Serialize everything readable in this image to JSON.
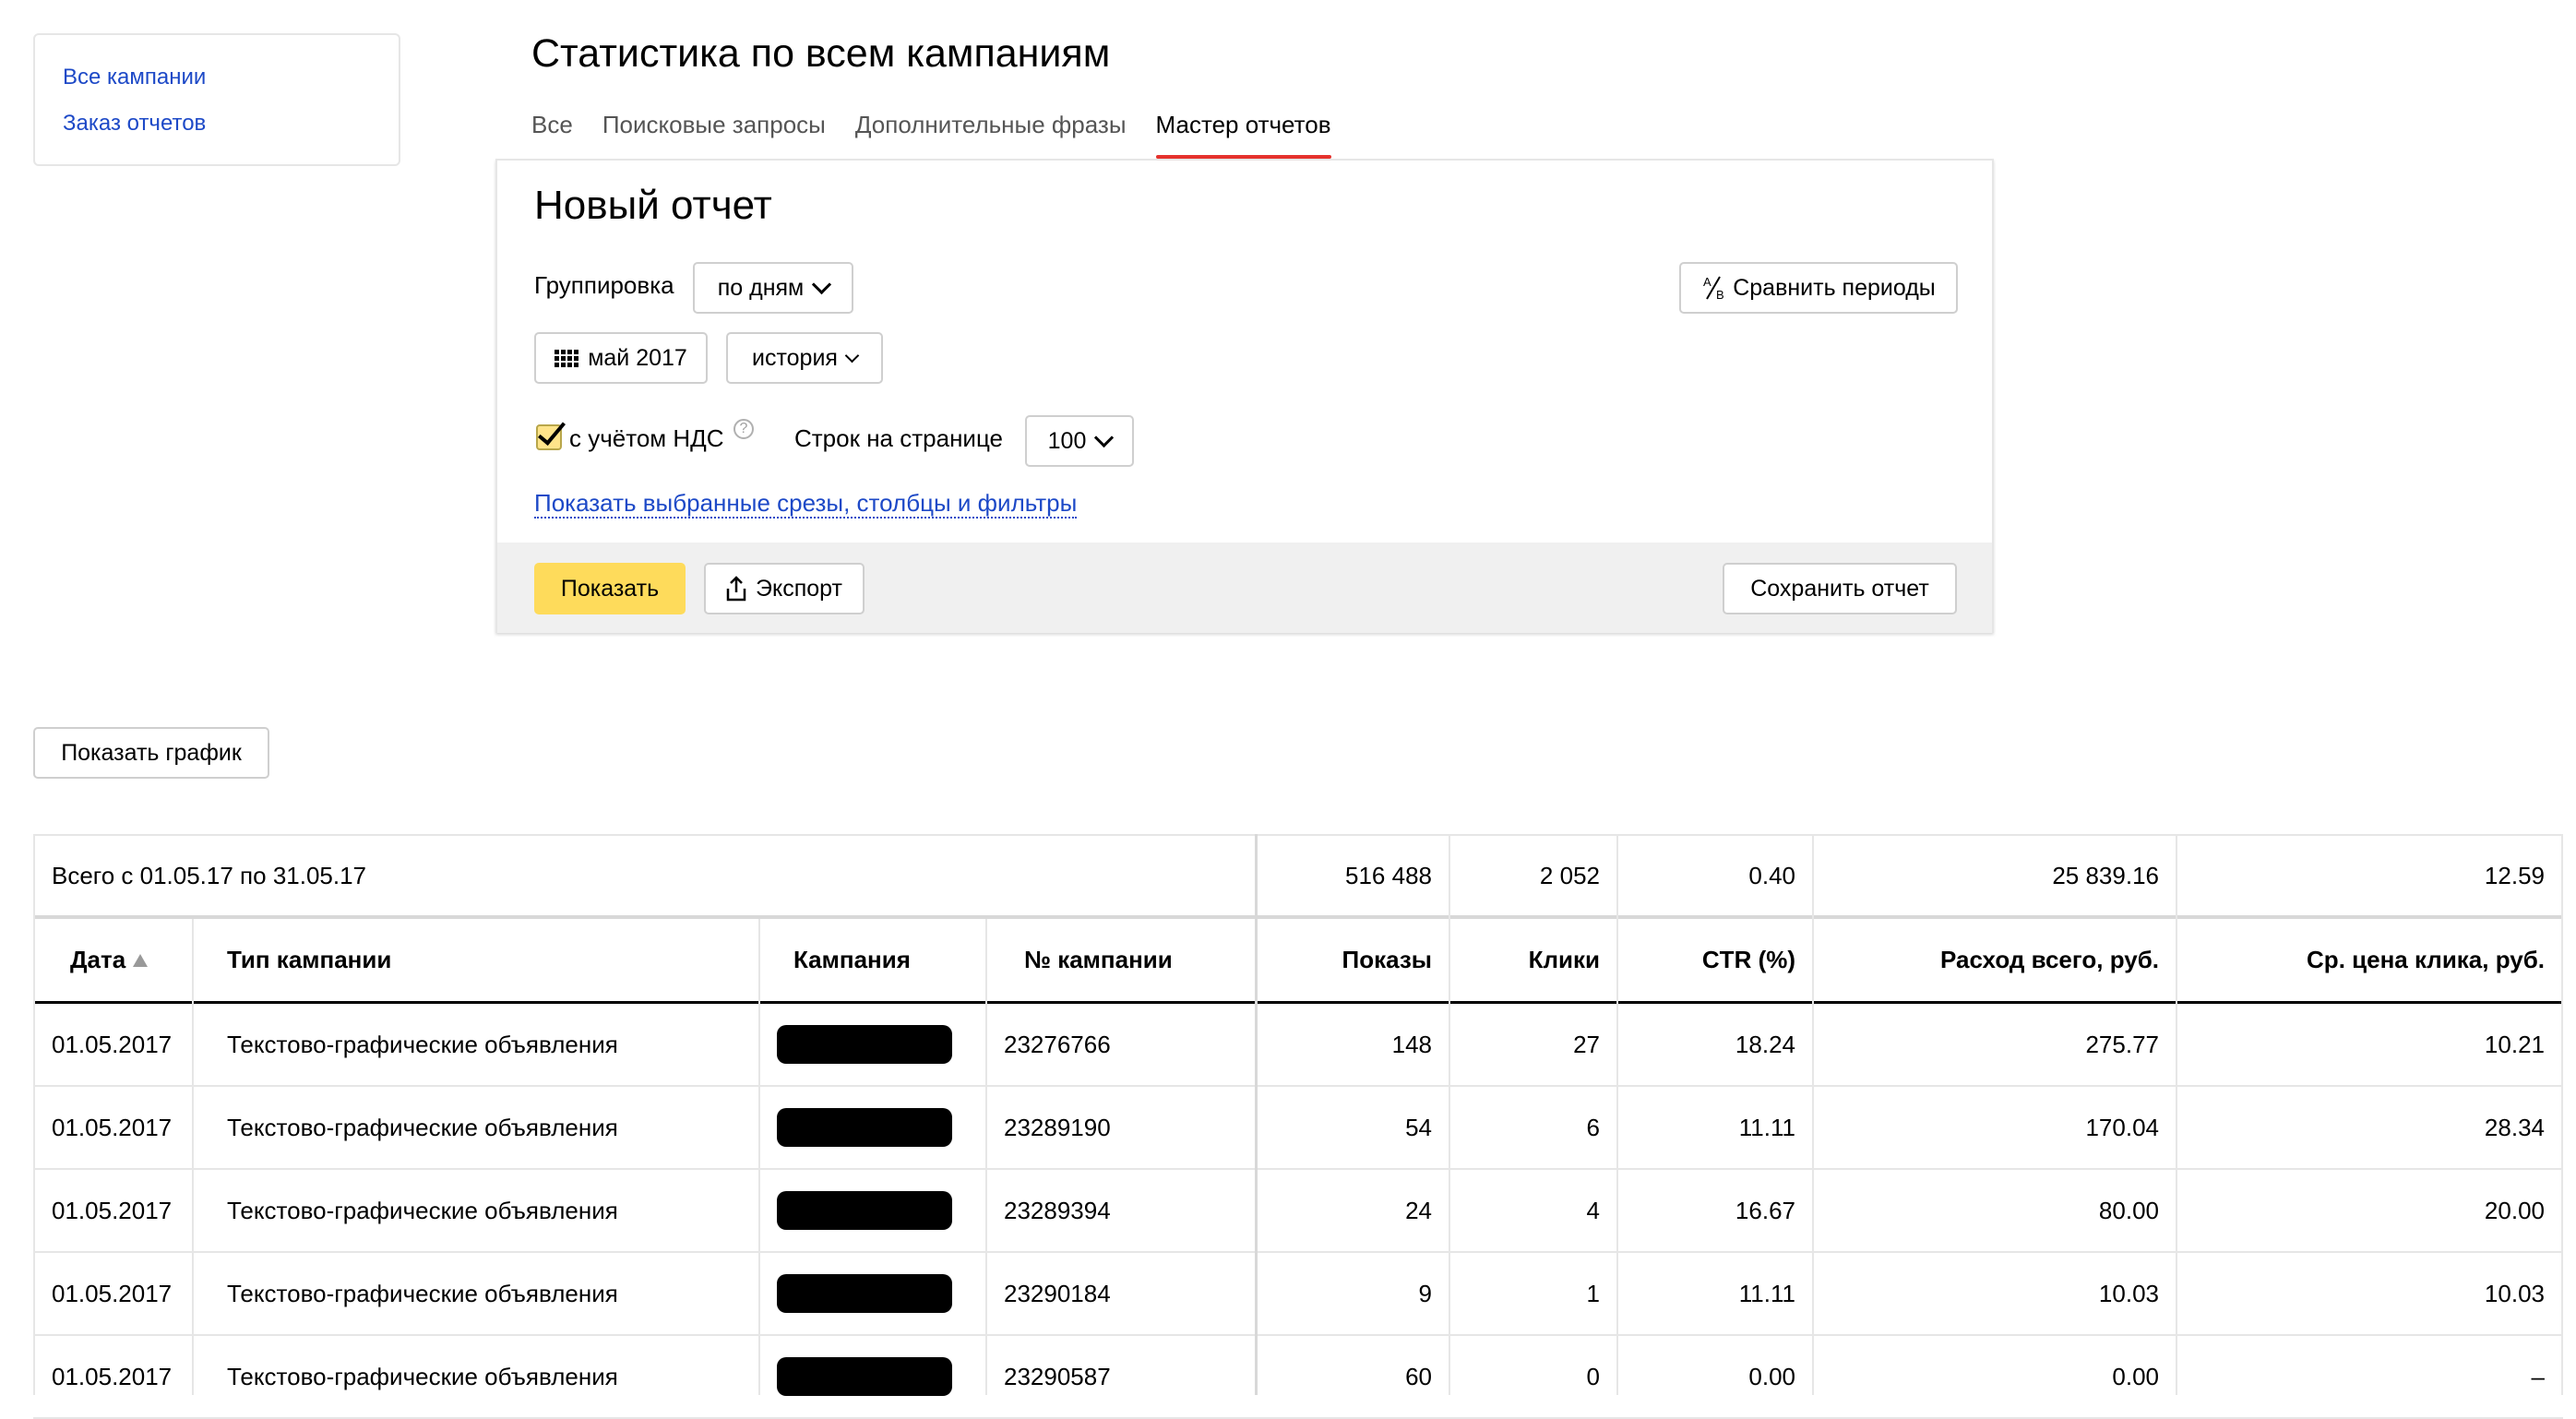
{
  "sidebar": {
    "links": [
      "Все кампании",
      "Заказ отчетов"
    ]
  },
  "page": {
    "title": "Статистика по всем кампаниям",
    "tabs": [
      {
        "label": "Все",
        "active": false
      },
      {
        "label": "Поисковые запросы",
        "active": false
      },
      {
        "label": "Дополнительные фразы",
        "active": false
      },
      {
        "label": "Мастер отчетов",
        "active": true
      }
    ]
  },
  "report": {
    "title": "Новый отчет",
    "grouping_label": "Группировка",
    "grouping_value": "по дням",
    "compare_label": "Сравнить периоды",
    "compare_icon": "a-slash-b-icon",
    "period_value": "май 2017",
    "period_icon": "calendar-grid-icon",
    "history_value": "история",
    "vat_checked": true,
    "vat_label": "с учётом НДС",
    "help_symbol": "?",
    "rows_label": "Строк на странице",
    "rows_value": "100",
    "filters_link": "Показать выбранные срезы, столбцы и фильтры",
    "show_button": "Показать",
    "export_button": "Экспорт",
    "save_button": "Сохранить отчет",
    "accent_color": "#fedb5b",
    "tab_underline_color": "#e5322d",
    "link_color": "#1d49c7"
  },
  "chart_toggle": "Показать график",
  "table": {
    "total": {
      "label": "Всего с 01.05.17 по 31.05.17",
      "impressions": "516 488",
      "clicks": "2 052",
      "ctr": "0.40",
      "cost": "25 839.16",
      "avg_cpc": "12.59"
    },
    "columns": [
      "Дата",
      "Тип кампании",
      "Кампания",
      "№ кампании",
      "Показы",
      "Клики",
      "CTR (%)",
      "Расход всего, руб.",
      "Ср. цена клика, руб."
    ],
    "sorted_column": "Дата",
    "rows": [
      {
        "date": "01.05.2017",
        "type": "Текстово-графические объявления",
        "campaign_redacted": true,
        "id": "23276766",
        "impressions": "148",
        "clicks": "27",
        "ctr": "18.24",
        "cost": "275.77",
        "avg_cpc": "10.21"
      },
      {
        "date": "01.05.2017",
        "type": "Текстово-графические объявления",
        "campaign_redacted": true,
        "id": "23289190",
        "impressions": "54",
        "clicks": "6",
        "ctr": "11.11",
        "cost": "170.04",
        "avg_cpc": "28.34"
      },
      {
        "date": "01.05.2017",
        "type": "Текстово-графические объявления",
        "campaign_redacted": true,
        "id": "23289394",
        "impressions": "24",
        "clicks": "4",
        "ctr": "16.67",
        "cost": "80.00",
        "avg_cpc": "20.00"
      },
      {
        "date": "01.05.2017",
        "type": "Текстово-графические объявления",
        "campaign_redacted": true,
        "id": "23290184",
        "impressions": "9",
        "clicks": "1",
        "ctr": "11.11",
        "cost": "10.03",
        "avg_cpc": "10.03"
      },
      {
        "date": "01.05.2017",
        "type": "Текстово-графические объявления",
        "campaign_redacted": true,
        "id": "23290587",
        "impressions": "60",
        "clicks": "0",
        "ctr": "0.00",
        "cost": "0.00",
        "avg_cpc": "–"
      }
    ]
  }
}
